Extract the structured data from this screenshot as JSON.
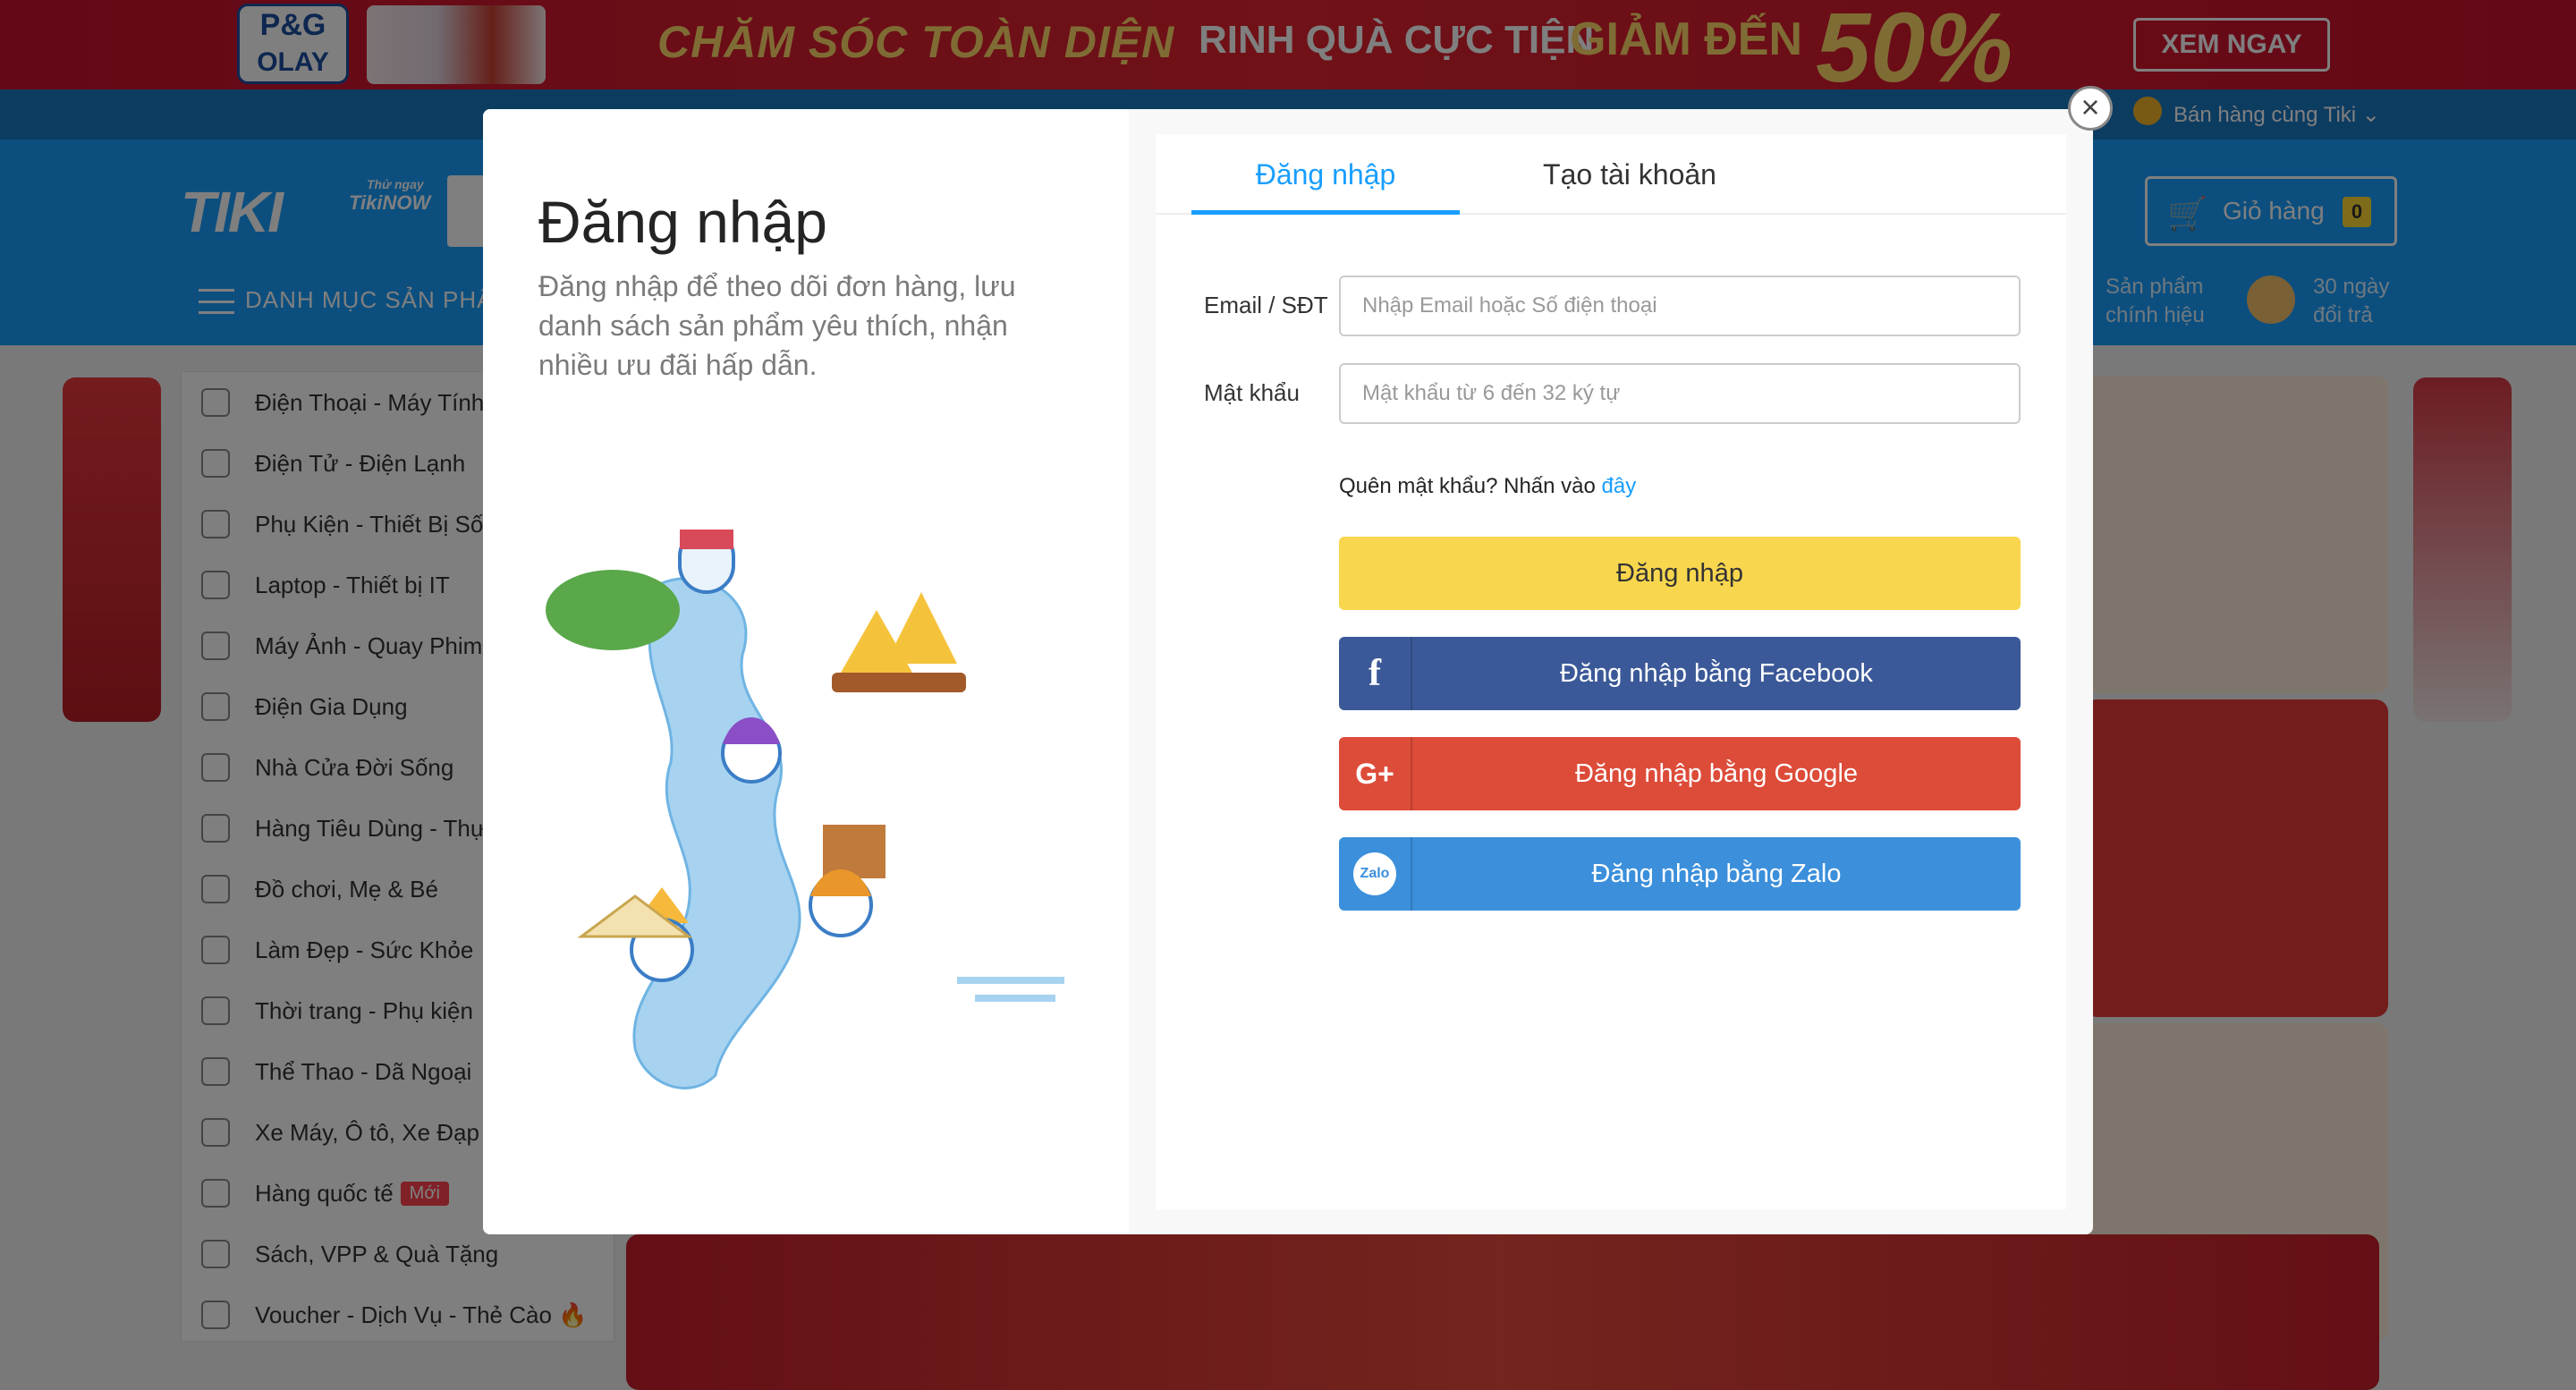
{
  "promo_banner": {
    "brand_line1": "P&G",
    "brand_line2": "OLAY",
    "headline": "CHĂM SÓC TOÀN DIỆN",
    "sub": "RINH QUÀ CỰC TIỆN",
    "discount_label": "GIẢM ĐẾN",
    "discount_value": "50%",
    "cta": "XEM NGAY"
  },
  "top_bar": {
    "sell_link": "Bán hàng cùng Tiki ⌄"
  },
  "header": {
    "logo": "TIKI",
    "tikinow_line1": "Thử ngay",
    "tikinow_line2": "TikiNOW",
    "menu_label": "DANH MỤC SẢN PHẨ",
    "cart_label": "Giỏ hàng",
    "cart_count": "0",
    "info1": "Sản phẩm chính hiệu",
    "info2": "30 ngày đổi trả"
  },
  "sidebar": {
    "items": [
      {
        "label": "Điện Thoại - Máy Tính B"
      },
      {
        "label": "Điện Tử - Điện Lạnh"
      },
      {
        "label": "Phụ Kiện - Thiết Bị Số"
      },
      {
        "label": "Laptop - Thiết bị IT"
      },
      {
        "label": "Máy Ảnh - Quay Phim"
      },
      {
        "label": "Điện Gia Dụng"
      },
      {
        "label": "Nhà Cửa Đời Sống"
      },
      {
        "label": "Hàng Tiêu Dùng - Thực"
      },
      {
        "label": "Đồ chơi, Mẹ & Bé"
      },
      {
        "label": "Làm Đẹp - Sức Khỏe"
      },
      {
        "label": "Thời trang - Phụ kiện"
      },
      {
        "label": "Thể Thao - Dã Ngoại"
      },
      {
        "label": "Xe Máy, Ô tô, Xe Đạp"
      },
      {
        "label": "Hàng quốc tế",
        "badge": "Mới"
      },
      {
        "label": "Sách, VPP & Quà Tặng"
      },
      {
        "label": "Voucher - Dịch Vụ - Thẻ Cào 🔥"
      }
    ]
  },
  "login_modal": {
    "title": "Đăng nhập",
    "description": "Đăng nhập để theo dõi đơn hàng, lưu danh sách sản phẩm yêu thích, nhận nhiều ưu đãi hấp dẫn.",
    "tabs": {
      "login": "Đăng nhập",
      "register": "Tạo tài khoản"
    },
    "email_label": "Email / SĐT",
    "email_placeholder": "Nhập Email hoặc Số điện thoại",
    "email_value": "",
    "password_label": "Mật khẩu",
    "password_placeholder": "Mật khẩu từ 6 đến 32 ký tự",
    "password_value": "",
    "forgot_text": "Quên mật khẩu? Nhấn vào ",
    "forgot_link": "đây",
    "submit": "Đăng nhập",
    "facebook": "Đăng nhập bằng Facebook",
    "google": "Đăng nhập bằng Google",
    "zalo": "Đăng nhập bằng Zalo",
    "facebook_icon": "f",
    "google_icon": "G+",
    "zalo_icon": "Zalo",
    "close": "×"
  },
  "colors": {
    "accent": "#189eff",
    "submit_bg": "#f8d64e",
    "facebook_bg": "#3b5998",
    "google_bg": "#dd4b39",
    "zalo_bg": "#3b8fdb"
  }
}
